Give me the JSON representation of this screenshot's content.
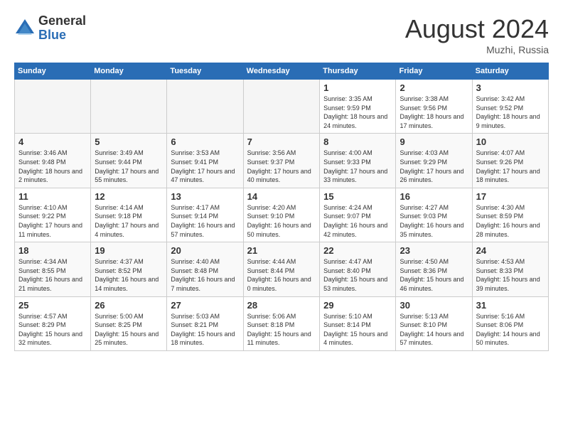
{
  "logo": {
    "general": "General",
    "blue": "Blue"
  },
  "title": "August 2024",
  "location": "Muzhi, Russia",
  "days_of_week": [
    "Sunday",
    "Monday",
    "Tuesday",
    "Wednesday",
    "Thursday",
    "Friday",
    "Saturday"
  ],
  "weeks": [
    [
      {
        "day": "",
        "detail": ""
      },
      {
        "day": "",
        "detail": ""
      },
      {
        "day": "",
        "detail": ""
      },
      {
        "day": "",
        "detail": ""
      },
      {
        "day": "1",
        "detail": "Sunrise: 3:35 AM\nSunset: 9:59 PM\nDaylight: 18 hours and 24 minutes."
      },
      {
        "day": "2",
        "detail": "Sunrise: 3:38 AM\nSunset: 9:56 PM\nDaylight: 18 hours and 17 minutes."
      },
      {
        "day": "3",
        "detail": "Sunrise: 3:42 AM\nSunset: 9:52 PM\nDaylight: 18 hours and 9 minutes."
      }
    ],
    [
      {
        "day": "4",
        "detail": "Sunrise: 3:46 AM\nSunset: 9:48 PM\nDaylight: 18 hours and 2 minutes."
      },
      {
        "day": "5",
        "detail": "Sunrise: 3:49 AM\nSunset: 9:44 PM\nDaylight: 17 hours and 55 minutes."
      },
      {
        "day": "6",
        "detail": "Sunrise: 3:53 AM\nSunset: 9:41 PM\nDaylight: 17 hours and 47 minutes."
      },
      {
        "day": "7",
        "detail": "Sunrise: 3:56 AM\nSunset: 9:37 PM\nDaylight: 17 hours and 40 minutes."
      },
      {
        "day": "8",
        "detail": "Sunrise: 4:00 AM\nSunset: 9:33 PM\nDaylight: 17 hours and 33 minutes."
      },
      {
        "day": "9",
        "detail": "Sunrise: 4:03 AM\nSunset: 9:29 PM\nDaylight: 17 hours and 26 minutes."
      },
      {
        "day": "10",
        "detail": "Sunrise: 4:07 AM\nSunset: 9:26 PM\nDaylight: 17 hours and 18 minutes."
      }
    ],
    [
      {
        "day": "11",
        "detail": "Sunrise: 4:10 AM\nSunset: 9:22 PM\nDaylight: 17 hours and 11 minutes."
      },
      {
        "day": "12",
        "detail": "Sunrise: 4:14 AM\nSunset: 9:18 PM\nDaylight: 17 hours and 4 minutes."
      },
      {
        "day": "13",
        "detail": "Sunrise: 4:17 AM\nSunset: 9:14 PM\nDaylight: 16 hours and 57 minutes."
      },
      {
        "day": "14",
        "detail": "Sunrise: 4:20 AM\nSunset: 9:10 PM\nDaylight: 16 hours and 50 minutes."
      },
      {
        "day": "15",
        "detail": "Sunrise: 4:24 AM\nSunset: 9:07 PM\nDaylight: 16 hours and 42 minutes."
      },
      {
        "day": "16",
        "detail": "Sunrise: 4:27 AM\nSunset: 9:03 PM\nDaylight: 16 hours and 35 minutes."
      },
      {
        "day": "17",
        "detail": "Sunrise: 4:30 AM\nSunset: 8:59 PM\nDaylight: 16 hours and 28 minutes."
      }
    ],
    [
      {
        "day": "18",
        "detail": "Sunrise: 4:34 AM\nSunset: 8:55 PM\nDaylight: 16 hours and 21 minutes."
      },
      {
        "day": "19",
        "detail": "Sunrise: 4:37 AM\nSunset: 8:52 PM\nDaylight: 16 hours and 14 minutes."
      },
      {
        "day": "20",
        "detail": "Sunrise: 4:40 AM\nSunset: 8:48 PM\nDaylight: 16 hours and 7 minutes."
      },
      {
        "day": "21",
        "detail": "Sunrise: 4:44 AM\nSunset: 8:44 PM\nDaylight: 16 hours and 0 minutes."
      },
      {
        "day": "22",
        "detail": "Sunrise: 4:47 AM\nSunset: 8:40 PM\nDaylight: 15 hours and 53 minutes."
      },
      {
        "day": "23",
        "detail": "Sunrise: 4:50 AM\nSunset: 8:36 PM\nDaylight: 15 hours and 46 minutes."
      },
      {
        "day": "24",
        "detail": "Sunrise: 4:53 AM\nSunset: 8:33 PM\nDaylight: 15 hours and 39 minutes."
      }
    ],
    [
      {
        "day": "25",
        "detail": "Sunrise: 4:57 AM\nSunset: 8:29 PM\nDaylight: 15 hours and 32 minutes."
      },
      {
        "day": "26",
        "detail": "Sunrise: 5:00 AM\nSunset: 8:25 PM\nDaylight: 15 hours and 25 minutes."
      },
      {
        "day": "27",
        "detail": "Sunrise: 5:03 AM\nSunset: 8:21 PM\nDaylight: 15 hours and 18 minutes."
      },
      {
        "day": "28",
        "detail": "Sunrise: 5:06 AM\nSunset: 8:18 PM\nDaylight: 15 hours and 11 minutes."
      },
      {
        "day": "29",
        "detail": "Sunrise: 5:10 AM\nSunset: 8:14 PM\nDaylight: 15 hours and 4 minutes."
      },
      {
        "day": "30",
        "detail": "Sunrise: 5:13 AM\nSunset: 8:10 PM\nDaylight: 14 hours and 57 minutes."
      },
      {
        "day": "31",
        "detail": "Sunrise: 5:16 AM\nSunset: 8:06 PM\nDaylight: 14 hours and 50 minutes."
      }
    ]
  ]
}
